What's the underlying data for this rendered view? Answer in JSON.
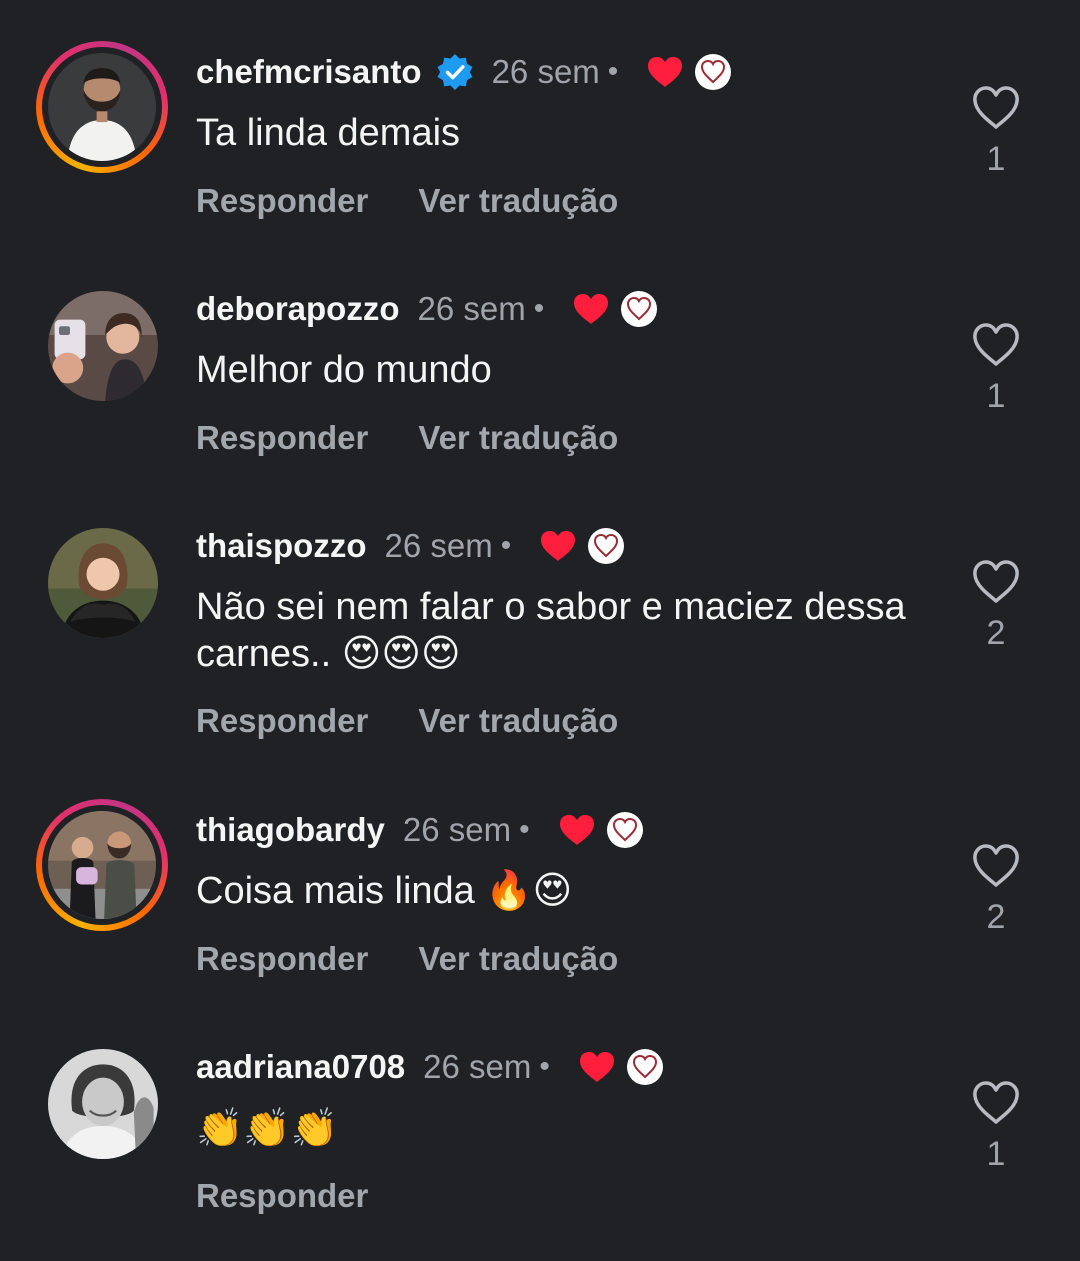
{
  "colors": {
    "background": "#202125",
    "secondary_text": "#a0a4ab",
    "verified_badge": "#1d9bf0",
    "creator_heart": "#ff1f3d"
  },
  "comments": [
    {
      "username": "chefmcrisanto",
      "verified": true,
      "has_story_ring": true,
      "time": "26 sem",
      "separator": "•",
      "text": "Ta linda demais",
      "reply_label": "Responder",
      "translate_label": "Ver tradução",
      "like_count": "1",
      "icons": [
        "verified-badge-icon",
        "creator-heart-icon",
        "creator-like-icon",
        "like-heart-icon"
      ]
    },
    {
      "username": "deborapozzo",
      "verified": false,
      "has_story_ring": false,
      "time": "26 sem",
      "separator": "•",
      "text": "Melhor do mundo",
      "reply_label": "Responder",
      "translate_label": "Ver tradução",
      "like_count": "1",
      "icons": [
        "creator-heart-icon",
        "creator-like-icon",
        "like-heart-icon"
      ]
    },
    {
      "username": "thaispozzo",
      "verified": false,
      "has_story_ring": false,
      "time": "26 sem",
      "separator": "•",
      "text": "Não sei nem falar o sabor e maciez dessa carnes.. 😍😍😍",
      "reply_label": "Responder",
      "translate_label": "Ver tradução",
      "like_count": "2",
      "icons": [
        "creator-heart-icon",
        "creator-like-icon",
        "like-heart-icon"
      ]
    },
    {
      "username": "thiagobardy",
      "verified": false,
      "has_story_ring": true,
      "time": "26 sem",
      "separator": "•",
      "text": "Coisa mais linda 🔥😍",
      "reply_label": "Responder",
      "translate_label": "Ver tradução",
      "like_count": "2",
      "icons": [
        "creator-heart-icon",
        "creator-like-icon",
        "like-heart-icon"
      ]
    },
    {
      "username": "aadriana0708",
      "verified": false,
      "has_story_ring": false,
      "time": "26 sem",
      "separator": "•",
      "text": "👏👏👏",
      "reply_label": "Responder",
      "translate_label": "",
      "like_count": "1",
      "icons": [
        "creator-heart-icon",
        "creator-like-icon",
        "like-heart-icon"
      ]
    }
  ]
}
